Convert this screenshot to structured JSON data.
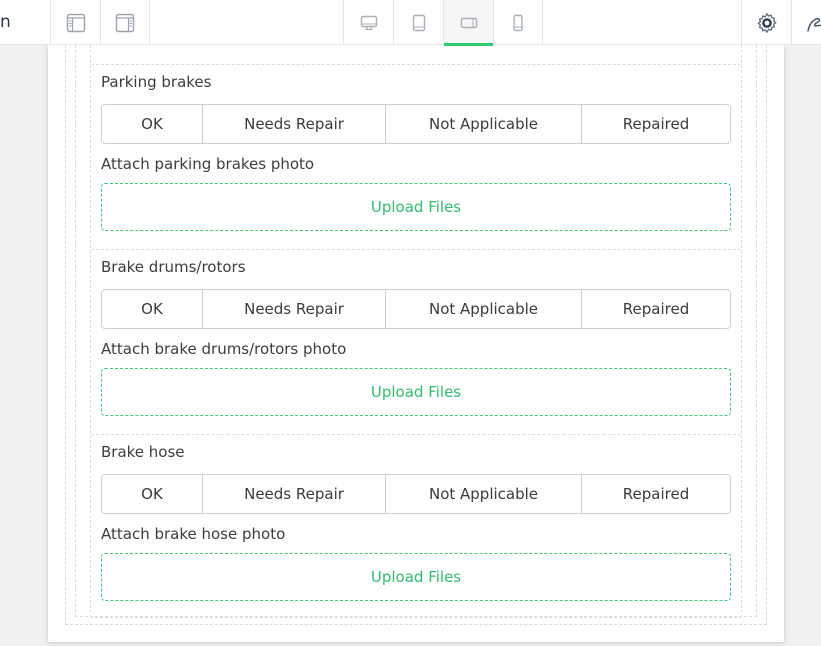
{
  "toolbar": {
    "title_fragment": "n",
    "layout_buttons": [
      {
        "icon": "layout-left-sidebar-icon"
      },
      {
        "icon": "layout-right-sidebar-icon"
      }
    ],
    "device_buttons": [
      {
        "icon": "desktop-icon",
        "active": false
      },
      {
        "icon": "tablet-portrait-icon",
        "active": false
      },
      {
        "icon": "tablet-landscape-icon",
        "active": true
      },
      {
        "icon": "mobile-icon",
        "active": false
      }
    ],
    "settings_icon": "gear-icon",
    "extra_icon": "signature-icon",
    "accent_color": "#2ecc71"
  },
  "form": {
    "options": [
      "OK",
      "Needs Repair",
      "Not Applicable",
      "Repaired"
    ],
    "upload_label": "Upload Files",
    "upload_color": "#2fbf6e",
    "sections": [
      {
        "question": "Parking brakes",
        "attach_label": "Attach parking brakes photo"
      },
      {
        "question": "Brake drums/rotors",
        "attach_label": "Attach brake drums/rotors photo"
      },
      {
        "question": "Brake hose",
        "attach_label": "Attach brake hose photo"
      }
    ]
  }
}
